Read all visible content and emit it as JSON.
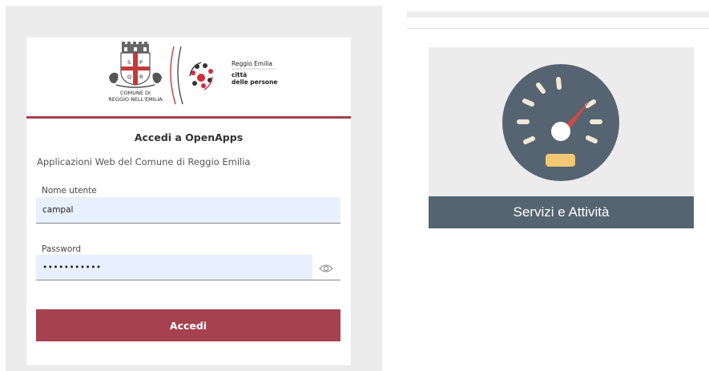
{
  "login": {
    "logo": {
      "crest_letters": [
        "S",
        "P",
        "Q",
        "R"
      ],
      "comune_line1": "COMUNE DI",
      "comune_line2": "REGGIO NELL'EMILIA",
      "city_name": "Reggio Emilia",
      "slogan_line1": "città",
      "slogan_line2": "delle persone"
    },
    "title": "Accedi a OpenApps",
    "subtitle": "Applicazioni Web del Comune di Reggio Emilia",
    "username_label": "Nome utente",
    "username_value": "campal",
    "password_label": "Password",
    "password_value": "•••••••••••",
    "show_password_icon": "eye-icon",
    "submit_label": "Accedi"
  },
  "tile": {
    "icon": "speedometer-icon",
    "label": "Servizi e Attività"
  },
  "colors": {
    "accent": "#a6414f",
    "field_bg": "#e8f0fe",
    "gauge_face": "#556470",
    "tile_footer": "#546470"
  }
}
